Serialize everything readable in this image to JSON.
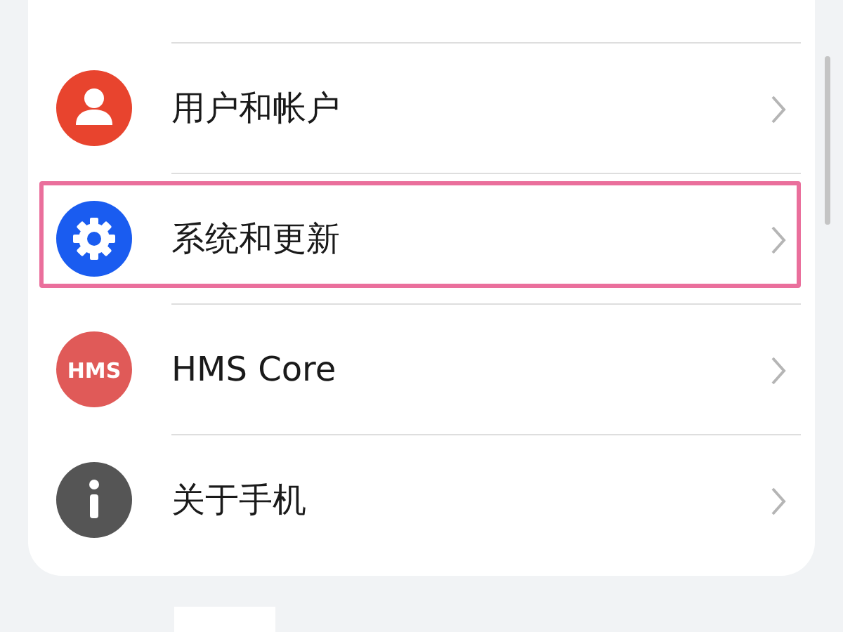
{
  "settings_items": [
    {
      "label": "用户和帐户",
      "kind": "user",
      "color": "#e8442e",
      "highlighted": false
    },
    {
      "label": "系统和更新",
      "kind": "gear",
      "color": "#1a5cf0",
      "highlighted": true
    },
    {
      "label": "HMS Core",
      "kind": "hms",
      "icon_text": "HMS",
      "color": "#e05a58",
      "highlighted": false
    },
    {
      "label": "关于手机",
      "kind": "info",
      "color": "#555555",
      "highlighted": false
    }
  ]
}
